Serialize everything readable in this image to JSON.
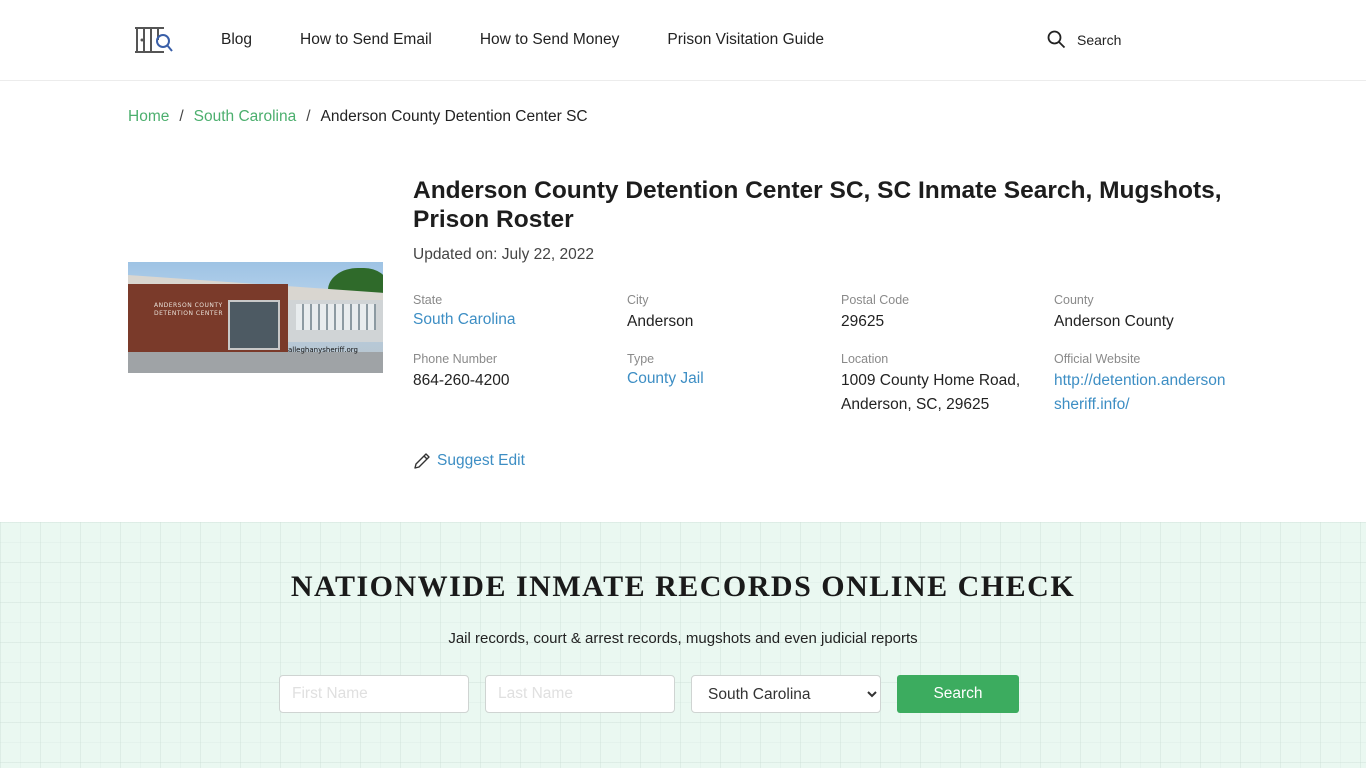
{
  "header": {
    "logo_icon": "prison-bars-magnifier-icon",
    "nav": [
      {
        "label": "Blog"
      },
      {
        "label": "How to Send Email"
      },
      {
        "label": "How to Send Money"
      },
      {
        "label": "Prison Visitation Guide"
      }
    ],
    "search_label": "Search",
    "search_icon": "search-icon"
  },
  "breadcrumb": {
    "items": [
      {
        "label": "Home"
      },
      {
        "label": "South Carolina"
      }
    ],
    "separator": "/",
    "current": "Anderson County Detention Center SC"
  },
  "facility": {
    "photo": {
      "sign_text": "ANDERSON COUNTY DETENTION CENTER",
      "watermark": "alleghanysheriff.org"
    },
    "title": "Anderson County Detention Center SC, SC Inmate Search, Mugshots, Prison Roster",
    "updated": "Updated on: July 22, 2022",
    "fields": [
      {
        "label": "State",
        "value": "South Carolina",
        "link": true
      },
      {
        "label": "City",
        "value": "Anderson",
        "link": false
      },
      {
        "label": "Postal Code",
        "value": "29625",
        "link": false
      },
      {
        "label": "County",
        "value": "Anderson County",
        "link": false
      },
      {
        "label": "Phone Number",
        "value": "864-260-4200",
        "link": false
      },
      {
        "label": "Type",
        "value": "County Jail",
        "link": true
      },
      {
        "label": "Location",
        "value_line1": "1009 County Home Road,",
        "value_line2": "Anderson, SC, 29625",
        "link": false
      },
      {
        "label": "Official Website",
        "value_line1": "http://detention.anderson",
        "value_line2": "sheriff.info/",
        "link": true
      }
    ],
    "suggest_edit": "Suggest Edit"
  },
  "promo": {
    "heading": "NATIONWIDE INMATE RECORDS ONLINE CHECK",
    "subheading": "Jail records, court & arrest records, mugshots and even judicial reports",
    "first_name_placeholder": "First Name",
    "last_name_placeholder": "Last Name",
    "state_selected": "South Carolina",
    "search_button": "Search"
  },
  "colors": {
    "link_green": "#4caf6e",
    "link_blue": "#3d8ec4",
    "button_green": "#3cac5f",
    "promo_bg": "#eaf8f1"
  }
}
